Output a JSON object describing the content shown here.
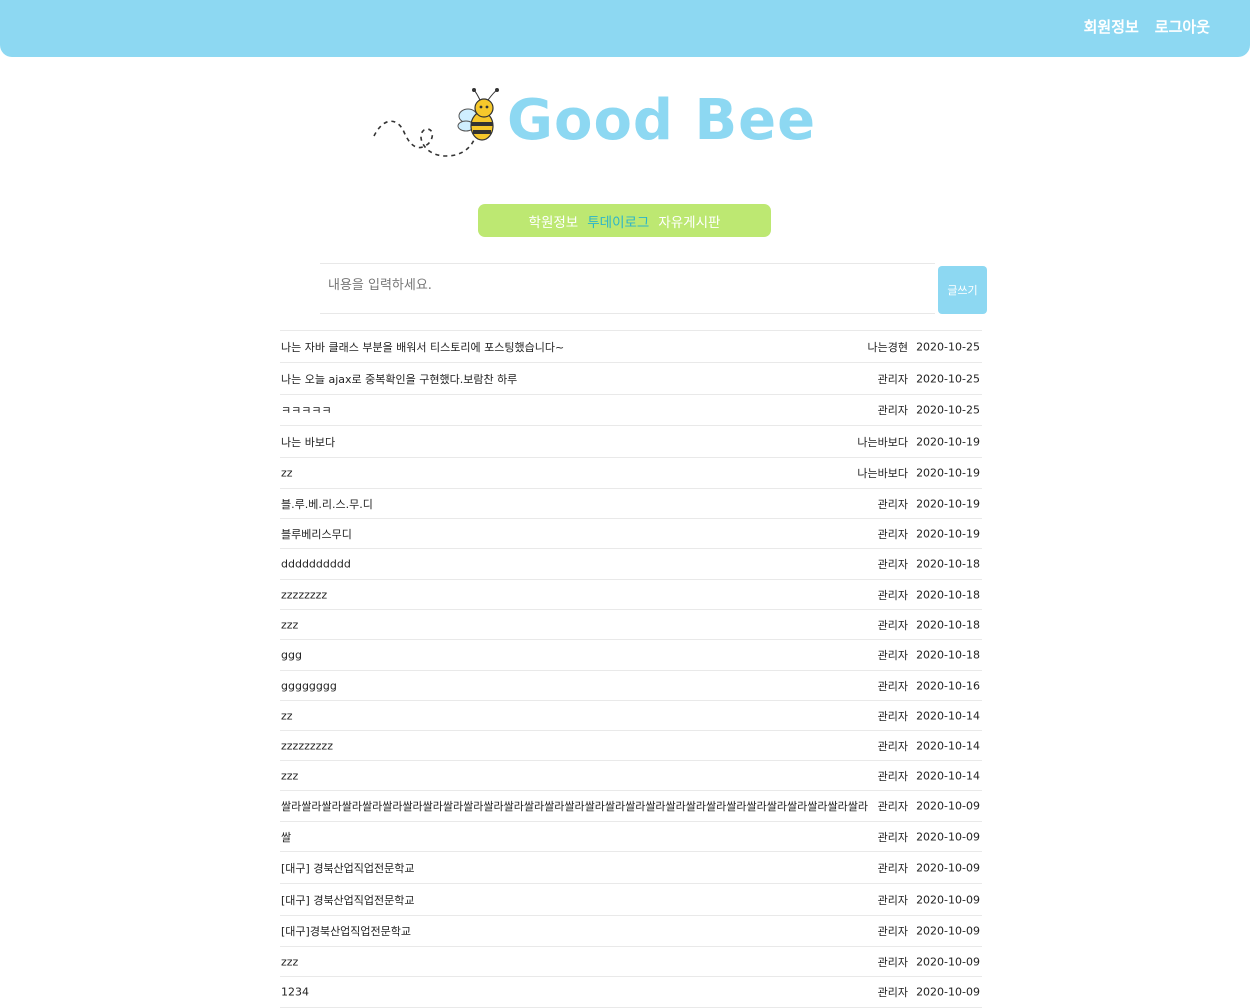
{
  "header": {
    "nav": [
      "회원정보",
      "로그아웃"
    ],
    "bg_color": "#8dd8f2"
  },
  "logo": {
    "text": "Good Bee",
    "icon": "bee-icon"
  },
  "menu": {
    "items": [
      "학원정보",
      "투데이로그",
      "자유게시판"
    ],
    "active": "투데이로그",
    "bg_color": "#bde872"
  },
  "write": {
    "placeholder": "내용을 입력하세요.",
    "button_label": "글쓰기"
  },
  "posts": [
    {
      "content": "나는 자바 클래스 부분을 배워서 티스토리에 포스팅했습니다~",
      "author": "나는경현",
      "date": "2020-10-25"
    },
    {
      "content": "나는 오늘 ajax로 중복확인을 구현했다.보람찬 하루",
      "author": "관리자",
      "date": "2020-10-25"
    },
    {
      "content": "ㅋㅋㅋㅋㅋ",
      "author": "관리자",
      "date": "2020-10-25"
    },
    {
      "content": "나는 바보다",
      "author": "나는바보다",
      "date": "2020-10-19"
    },
    {
      "content": "zz",
      "author": "나는바보다",
      "date": "2020-10-19"
    },
    {
      "content": "블.루.베.리.스.무.디",
      "author": "관리자",
      "date": "2020-10-19"
    },
    {
      "content": "블루베리스무디",
      "author": "관리자",
      "date": "2020-10-19"
    },
    {
      "content": "dddddddddd",
      "author": "관리자",
      "date": "2020-10-18"
    },
    {
      "content": "zzzzzzzz",
      "author": "관리자",
      "date": "2020-10-18"
    },
    {
      "content": "zzz",
      "author": "관리자",
      "date": "2020-10-18"
    },
    {
      "content": "ggg",
      "author": "관리자",
      "date": "2020-10-18"
    },
    {
      "content": "gggggggg",
      "author": "관리자",
      "date": "2020-10-16"
    },
    {
      "content": "zz",
      "author": "관리자",
      "date": "2020-10-14"
    },
    {
      "content": "zzzzzzzzz",
      "author": "관리자",
      "date": "2020-10-14"
    },
    {
      "content": "zzz",
      "author": "관리자",
      "date": "2020-10-14"
    },
    {
      "content": "쌀라쌀라쌀라쌀라쌀라쌀라쌀라쌀라쌀라쌀라쌀라쌀라쌀라쌀라쌀라쌀라쌀라쌀라쌀라쌀라쌀라쌀라쌀라쌀라쌀라쌀라쌀라쌀라쌀라",
      "author": "관리자",
      "date": "2020-10-09"
    },
    {
      "content": "쌀",
      "author": "관리자",
      "date": "2020-10-09"
    },
    {
      "content": "[대구] 경북산업직업전문학교",
      "author": "관리자",
      "date": "2020-10-09"
    },
    {
      "content": "[대구] 경북산업직업전문학교",
      "author": "관리자",
      "date": "2020-10-09"
    },
    {
      "content": "[대구]경북산업직업전문학교",
      "author": "관리자",
      "date": "2020-10-09"
    },
    {
      "content": "zzz",
      "author": "관리자",
      "date": "2020-10-09"
    },
    {
      "content": "1234",
      "author": "관리자",
      "date": "2020-10-09"
    }
  ]
}
